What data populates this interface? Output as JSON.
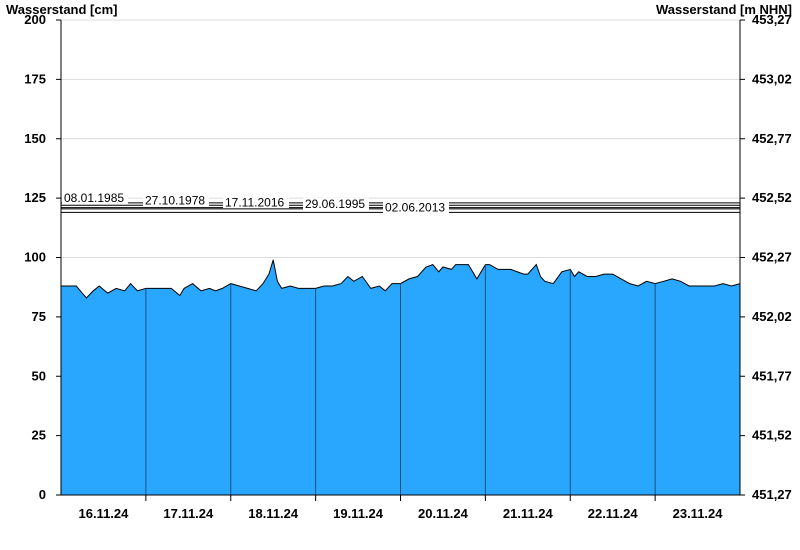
{
  "chart_data": {
    "type": "area",
    "ylabel": "Wasserstand [cm]",
    "ylabel_right": "Wasserstand [m NHN]",
    "ylim": [
      0,
      200
    ],
    "y_ticks": [
      0,
      25,
      50,
      75,
      100,
      125,
      150,
      175,
      200
    ],
    "y_ticks_right": [
      "451,27",
      "451,52",
      "451,77",
      "452,02",
      "452,27",
      "452,52",
      "452,77",
      "453,02",
      "453,27"
    ],
    "x_range_days": [
      0,
      8
    ],
    "x_tick_labels": [
      "16.11.24",
      "17.11.24",
      "18.11.24",
      "19.11.24",
      "20.11.24",
      "21.11.24",
      "22.11.24",
      "23.11.24"
    ],
    "grid": true,
    "fill_color": "#29A7FE",
    "reference_lines": [
      {
        "label": "08.01.1985",
        "value": 123
      },
      {
        "label": "27.10.1978",
        "value": 122
      },
      {
        "label": "17.11.2016",
        "value": 121
      },
      {
        "label": "29.06.1995",
        "value": 120.5
      },
      {
        "label": "02.06.2013",
        "value": 119
      }
    ],
    "series": [
      {
        "x": [
          0,
          0.18,
          0.25,
          0.3,
          0.38,
          0.45,
          0.55,
          0.65,
          0.75,
          0.82,
          0.9,
          1.0,
          1.1,
          1.3,
          1.4,
          1.45,
          1.55,
          1.65,
          1.75,
          1.82,
          1.9,
          2.0,
          2.1,
          2.2,
          2.3,
          2.38,
          2.45,
          2.5,
          2.55,
          2.6,
          2.7,
          2.8,
          2.9,
          3.0,
          3.1,
          3.2,
          3.3,
          3.38,
          3.45,
          3.55,
          3.65,
          3.75,
          3.82,
          3.9,
          4.0,
          4.1,
          4.2,
          4.3,
          4.38,
          4.45,
          4.5,
          4.6,
          4.65,
          4.72,
          4.8,
          4.9,
          5.0,
          5.05,
          5.15,
          5.3,
          5.45,
          5.5,
          5.6,
          5.65,
          5.7,
          5.8,
          5.9,
          6.0,
          6.05,
          6.1,
          6.2,
          6.3,
          6.4,
          6.5,
          6.6,
          6.7,
          6.8,
          6.9,
          7.0,
          7.1,
          7.2,
          7.3,
          7.4,
          7.5,
          7.6,
          7.7,
          7.8,
          7.9,
          8.0
        ],
        "y": [
          88,
          88,
          85,
          83,
          86,
          88,
          85,
          87,
          86,
          89,
          86,
          87,
          87,
          87,
          84,
          87,
          89,
          86,
          87,
          86,
          87,
          89,
          88,
          87,
          86,
          89,
          93,
          99,
          90,
          87,
          88,
          87,
          87,
          87,
          88,
          88,
          89,
          92,
          90,
          92,
          87,
          88,
          86,
          89,
          89,
          91,
          92,
          96,
          97,
          94,
          96,
          95,
          97,
          97,
          97,
          91,
          97,
          97,
          95,
          95,
          93,
          93,
          97,
          92,
          90,
          89,
          94,
          95,
          92,
          94,
          92,
          92,
          93,
          93,
          91,
          89,
          88,
          90,
          89,
          90,
          91,
          90,
          88,
          88,
          88,
          88,
          89,
          88,
          89
        ]
      }
    ]
  }
}
